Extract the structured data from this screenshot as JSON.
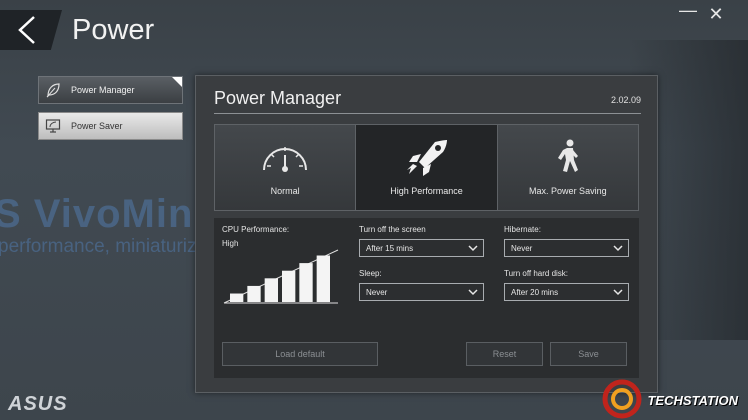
{
  "window": {
    "title": "Power",
    "minimize_glyph": "—",
    "close_glyph": "✕"
  },
  "background": {
    "brand_text": "S VivoMini",
    "tagline_text": "performance, miniaturiz"
  },
  "sidebar": {
    "items": [
      {
        "label": "Power Manager",
        "icon": "leaf-icon",
        "active": true
      },
      {
        "label": "Power Saver",
        "icon": "monitor-icon",
        "active": false
      }
    ]
  },
  "panel": {
    "title": "Power Manager",
    "version": "2.02.09",
    "modes": [
      {
        "label": "Normal",
        "icon": "gauge-icon",
        "selected": false
      },
      {
        "label": "High Performance",
        "icon": "rocket-icon",
        "selected": true
      },
      {
        "label": "Max. Power Saving",
        "icon": "walking-person-icon",
        "selected": false
      }
    ],
    "cpu": {
      "label": "CPU Performance:",
      "value": "High",
      "level_bars_lit": 6,
      "level_bars_total": 6
    },
    "fields": {
      "screen_off": {
        "label": "Turn off the screen",
        "value": "After 15 mins"
      },
      "hibernate": {
        "label": "Hibernate:",
        "value": "Never"
      },
      "sleep": {
        "label": "Sleep:",
        "value": "Never"
      },
      "hard_disk": {
        "label": "Turn off hard disk:",
        "value": "After 20 mins"
      }
    },
    "buttons": {
      "load_default": "Load default",
      "reset": "Reset",
      "save": "Save"
    }
  },
  "footer": {
    "brand": "ASUS",
    "watermark": "TECHSTATION"
  },
  "colors": {
    "panel_bg": "#3a3d40",
    "selected_mode_bg": "#232527",
    "brand_blue": "#5078aa",
    "watermark_red": "#c0241c",
    "watermark_orange": "#f0a020"
  }
}
